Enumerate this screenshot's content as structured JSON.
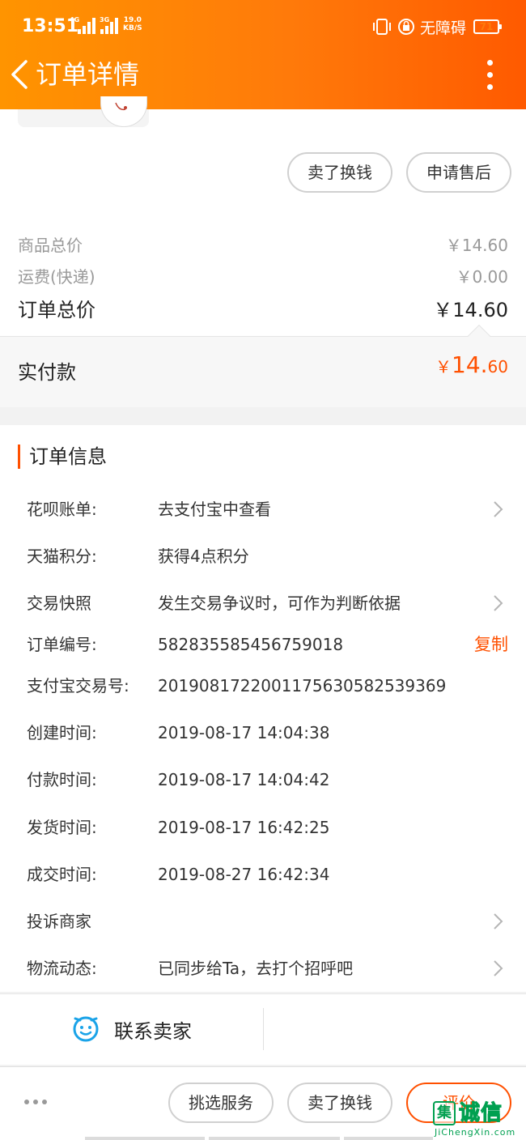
{
  "status_bar": {
    "time": "13:51",
    "net1": "4G",
    "net2": "3G",
    "speed_value": "19.0",
    "speed_unit": "KB/S",
    "accessibility": "无障碍",
    "battery": "71"
  },
  "nav": {
    "title": "订单详情",
    "back_icon": "chevron-left-icon",
    "more_icon": "more-vertical-icon"
  },
  "actions_top": {
    "sell_label": "卖了换钱",
    "after_sale_label": "申请售后"
  },
  "price": {
    "goods_label": "商品总价",
    "goods_value": "￥14.60",
    "shipping_label": "运费(快递)",
    "shipping_value": "￥0.00",
    "order_total_label": "订单总价",
    "order_total_value": "￥14.60",
    "paid_label": "实付款",
    "paid_currency": "￥",
    "paid_int": "14.",
    "paid_dec": "60"
  },
  "order_info": {
    "title": "订单信息",
    "rows": [
      {
        "key": "花呗账单:",
        "value": "去支付宝中查看",
        "chevron": true
      },
      {
        "key": "天猫积分:",
        "value": "获得4点积分",
        "chevron": false
      },
      {
        "key": "交易快照",
        "value": "发生交易争议时，可作为判断依据",
        "chevron": true
      },
      {
        "key": "订单编号:",
        "value": "582835585456759018",
        "chevron": false,
        "action": "复制"
      },
      {
        "key": "支付宝交易号:",
        "value": "2019081722001175630582539369",
        "chevron": false
      },
      {
        "key": "创建时间:",
        "value": "2019-08-17 14:04:38",
        "chevron": false
      },
      {
        "key": "付款时间:",
        "value": "2019-08-17 14:04:42",
        "chevron": false
      },
      {
        "key": "发货时间:",
        "value": "2019-08-17 16:42:25",
        "chevron": false
      },
      {
        "key": "成交时间:",
        "value": "2019-08-27 16:42:34",
        "chevron": false
      },
      {
        "key": "投诉商家",
        "value": "",
        "chevron": true
      },
      {
        "key": "物流动态:",
        "value": "已同步给Ta，去打个招呼吧",
        "chevron": true
      }
    ]
  },
  "contact": {
    "label": "联系卖家",
    "icon": "smiley-chat-icon"
  },
  "bottom_bar": {
    "choose_service": "挑选服务",
    "sell": "卖了换钱",
    "review": "评价"
  },
  "watermark": {
    "mark": "集",
    "text": "诚信",
    "sub": "JiChengXin.com"
  },
  "colors": {
    "header_start": "#ff9400",
    "header_end": "#ff5a00",
    "accent": "#ff5000",
    "contact_icon": "#1aa3e8"
  }
}
